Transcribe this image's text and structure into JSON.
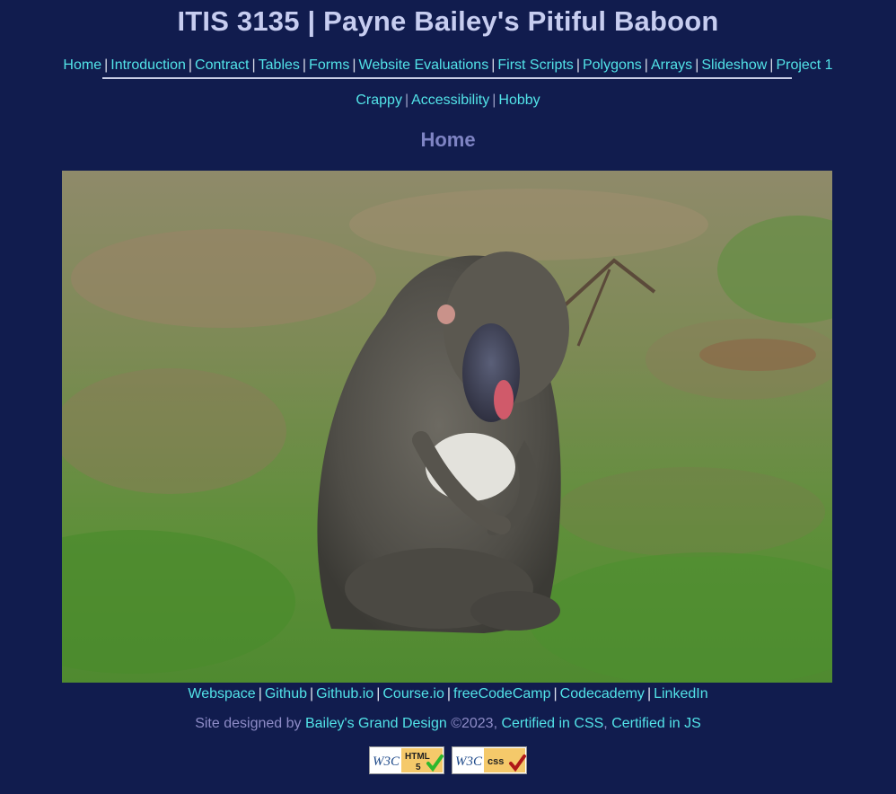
{
  "site": {
    "title": "ITIS 3135 | Payne Bailey's Pitiful Baboon"
  },
  "nav": {
    "row1": [
      {
        "label": "Home"
      },
      {
        "label": "Introduction"
      },
      {
        "label": "Contract"
      },
      {
        "label": "Tables"
      },
      {
        "label": "Forms"
      },
      {
        "label": "Website Evaluations"
      },
      {
        "label": "First Scripts"
      },
      {
        "label": "Polygons"
      },
      {
        "label": "Arrays"
      },
      {
        "label": "Slideshow"
      },
      {
        "label": "Project 1"
      }
    ],
    "row2": [
      {
        "label": "Crappy"
      },
      {
        "label": "Accessibility"
      },
      {
        "label": "Hobby"
      }
    ],
    "separator": "|"
  },
  "main": {
    "heading": "Home"
  },
  "footer": {
    "links": [
      {
        "label": "Webspace"
      },
      {
        "label": "Github"
      },
      {
        "label": "Github.io"
      },
      {
        "label": "Course.io"
      },
      {
        "label": "freeCodeCamp"
      },
      {
        "label": "Codecademy"
      },
      {
        "label": "LinkedIn"
      }
    ],
    "credits": {
      "prefix": "Site designed by ",
      "designer": "Bailey's Grand Design",
      "year": " ©2023, ",
      "cert_css": "Certified in CSS",
      "comma": ", ",
      "cert_js": "Certified in JS"
    },
    "badges": {
      "html": {
        "w3c": "W3C",
        "line1": "HTML",
        "line2": "5"
      },
      "css": {
        "w3c": "W3C",
        "line1": "css"
      }
    }
  },
  "colors": {
    "background": "#111c4e",
    "title": "#c7cdf0",
    "link": "#52e3e8",
    "heading": "#7f84c4",
    "credits_text": "#8e8cc7"
  }
}
